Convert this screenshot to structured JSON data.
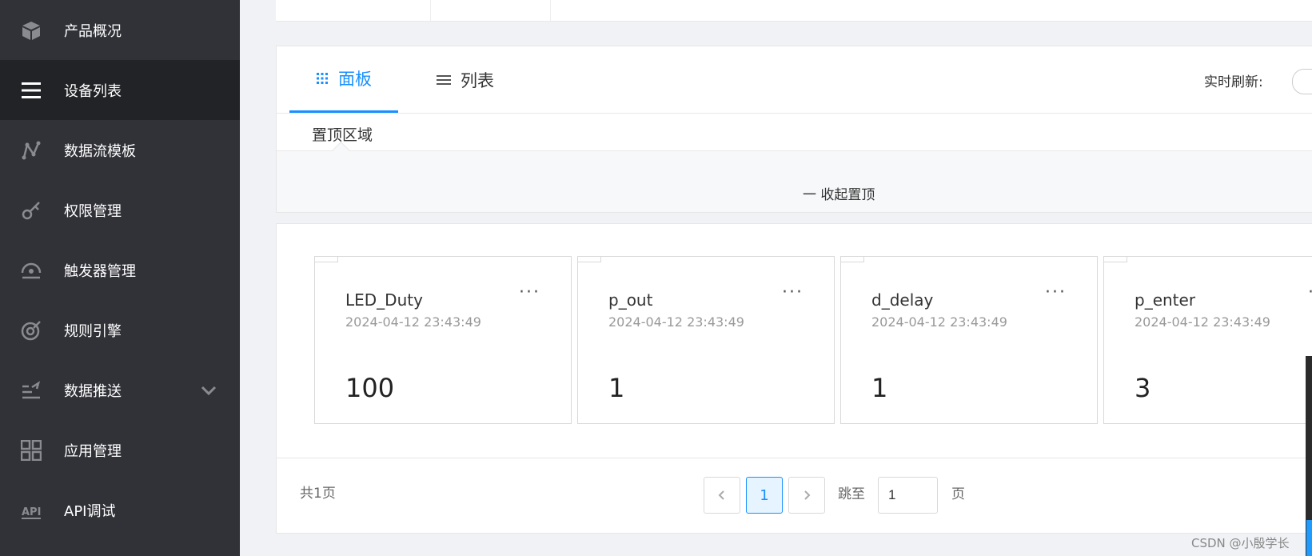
{
  "sidebar": {
    "items": [
      {
        "label": "产品概况",
        "icon": "cube-icon"
      },
      {
        "label": "设备列表",
        "icon": "list-icon",
        "active": true
      },
      {
        "label": "数据流模板",
        "icon": "flow-icon"
      },
      {
        "label": "权限管理",
        "icon": "key-icon"
      },
      {
        "label": "触发器管理",
        "icon": "trigger-icon"
      },
      {
        "label": "规则引擎",
        "icon": "rule-engine-icon"
      },
      {
        "label": "数据推送",
        "icon": "data-push-icon",
        "has_chevron": true
      },
      {
        "label": "应用管理",
        "icon": "apps-grid-icon"
      },
      {
        "label": "API调试",
        "icon": "api-icon"
      }
    ]
  },
  "tabs": {
    "board_label": "面板",
    "list_label": "列表",
    "active": "面板"
  },
  "refresh": {
    "label": "实时刷新:",
    "enabled": false
  },
  "pinned": {
    "title": "置顶区域",
    "collapse_label": "一 收起置顶"
  },
  "cards": [
    {
      "name": "LED_Duty",
      "time": "2024-04-12 23:43:49",
      "value": "100",
      "more": "···"
    },
    {
      "name": "p_out",
      "time": "2024-04-12 23:43:49",
      "value": "1",
      "more": "···"
    },
    {
      "name": "d_delay",
      "time": "2024-04-12 23:43:49",
      "value": "1",
      "more": "···"
    },
    {
      "name": "p_enter",
      "time": "2024-04-12 23:43:49",
      "value": "3",
      "more": "···"
    }
  ],
  "pagination": {
    "total_label": "共1页",
    "current_page": "1",
    "jump_label": "跳至",
    "jump_value": "1",
    "page_suffix": "页"
  },
  "watermark": "CSDN @小殷学长",
  "colors": {
    "accent": "#1890ff",
    "sidebar_bg": "#313238",
    "sidebar_active": "#222326"
  }
}
